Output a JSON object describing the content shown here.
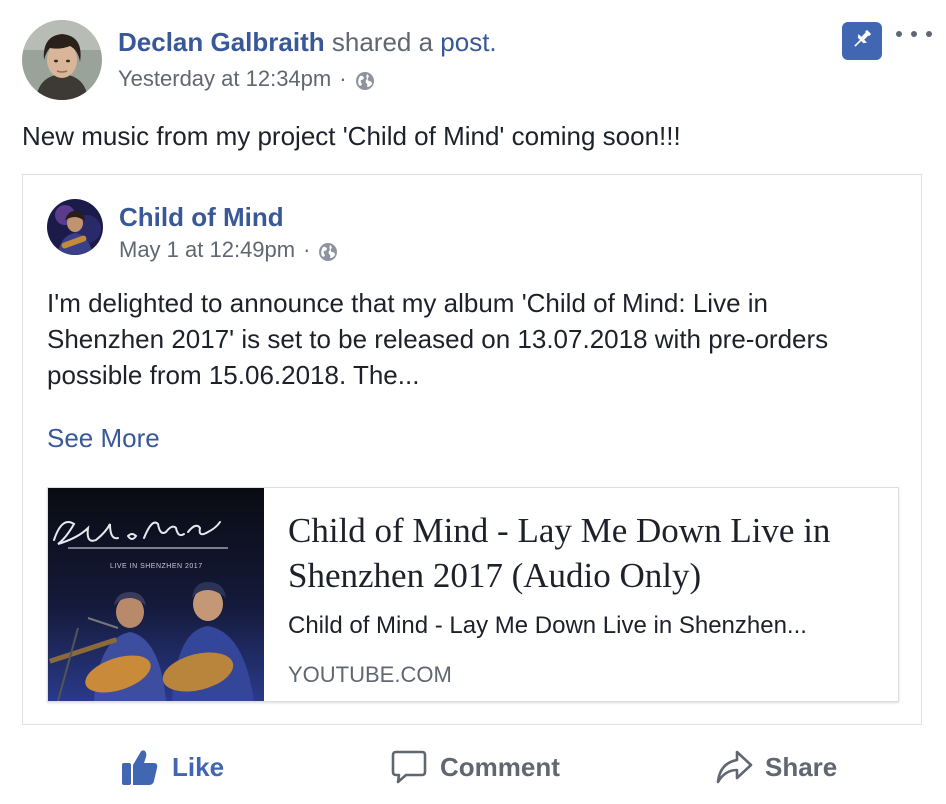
{
  "post": {
    "author": "Declan Galbraith",
    "shared_text": "shared a",
    "shared_link": "post.",
    "timestamp": "Yesterday at 12:34pm",
    "meta_separator": "·",
    "privacy_icon": "globe-icon",
    "pin_icon": "pin-icon",
    "more_icon": "more-options-icon",
    "text": "New music from my project 'Child of Mind' coming soon!!!"
  },
  "shared": {
    "author": "Child of Mind",
    "timestamp": "May 1 at 12:49pm",
    "meta_separator": "·",
    "text": "I'm delighted to announce that my album 'Child of Mind: Live in Shenzhen 2017' is set to be released on 13.07.2018 with pre-orders possible from 15.06.2018. The...",
    "see_more": "See More",
    "link": {
      "thumbnail_title": "Child of Mind",
      "thumbnail_subtitle": "LIVE IN SHENZHEN 2017",
      "title": "Child of Mind - Lay Me Down Live in Shenzhen 2017 (Audio Only)",
      "description": "Child of Mind - Lay Me Down Live in Shenzhen...",
      "domain": "YOUTUBE.COM"
    }
  },
  "actions": {
    "like": "Like",
    "comment": "Comment",
    "share": "Share"
  },
  "colors": {
    "link_blue": "#385898",
    "accent_blue": "#4267b2",
    "meta_gray": "#606770",
    "text": "#1d2129",
    "border": "#dddfe2"
  }
}
